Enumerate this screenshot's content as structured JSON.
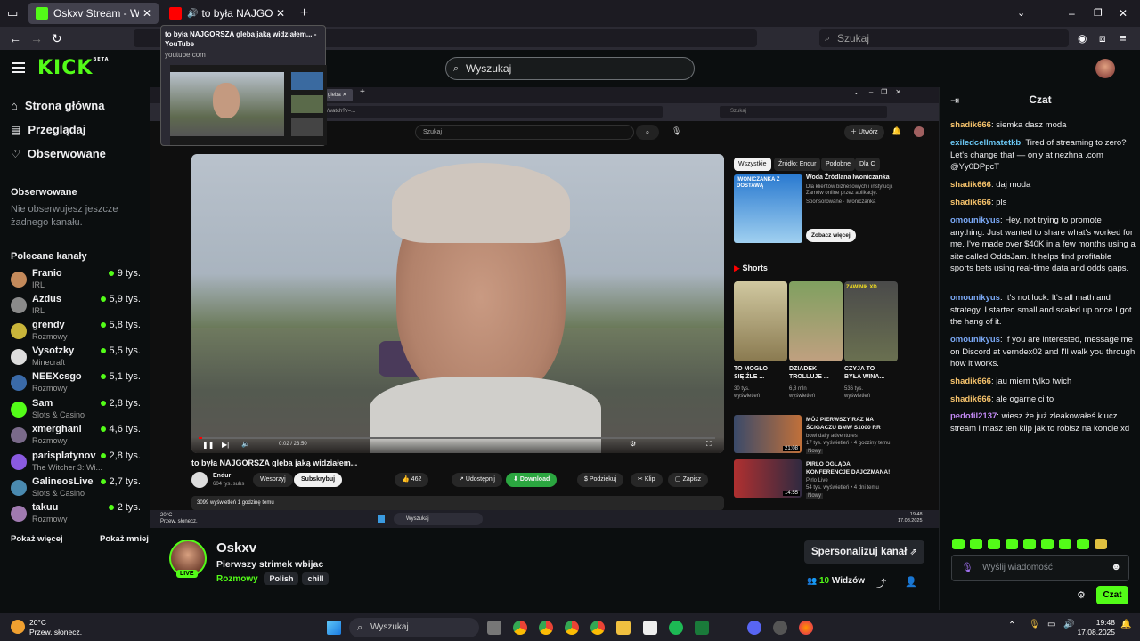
{
  "browser": {
    "tabs": [
      {
        "label": "Oskxv Stream - Watch Live on K",
        "active": true
      },
      {
        "label": "to była NAJGORSZA gleba",
        "active": false
      }
    ],
    "search_placeholder": "Szukaj",
    "tooltip": {
      "title": "to była NAJGORSZA gleba jaką widziałem... - YouTube",
      "domain": "youtube.com"
    }
  },
  "kick": {
    "logo": "KICK",
    "logo_badge": "BETA",
    "search_placeholder": "Wyszukaj",
    "nav": [
      {
        "icon": "home-icon",
        "label": "Strona główna"
      },
      {
        "icon": "browse-icon",
        "label": "Przeglądaj"
      },
      {
        "icon": "heart-icon",
        "label": "Obserwowane"
      }
    ],
    "following_heading": "Obserwowane",
    "following_empty": "Nie obserwujesz jeszcze żadnego kanału.",
    "recommended_heading": "Polecane kanały",
    "channels": [
      {
        "name": "Franio",
        "category": "IRL",
        "viewers": "9 tys.",
        "color": "#c48a5b"
      },
      {
        "name": "Azdus",
        "category": "IRL",
        "viewers": "5,9 tys.",
        "color": "#8a8a8a"
      },
      {
        "name": "grendy",
        "category": "Rozmowy",
        "viewers": "5,8 tys.",
        "color": "#c9b53a"
      },
      {
        "name": "Vysotzky",
        "category": "Minecraft",
        "viewers": "5,5 tys.",
        "color": "#dddddd"
      },
      {
        "name": "NEEXcsgo",
        "category": "Rozmowy",
        "viewers": "5,1 tys.",
        "color": "#3a6aa8"
      },
      {
        "name": "Sam",
        "category": "Slots & Casino",
        "viewers": "2,8 tys.",
        "color": "#53fc18"
      },
      {
        "name": "xmerghani",
        "category": "Rozmowy",
        "viewers": "4,6 tys.",
        "color": "#7a6a8a"
      },
      {
        "name": "parisplatynov",
        "category": "The Witcher 3: Wi...",
        "viewers": "2,8 tys.",
        "color": "#8a5ae0"
      },
      {
        "name": "GalineosLive",
        "category": "Slots & Casino",
        "viewers": "2,7 tys.",
        "color": "#4a8ab0"
      },
      {
        "name": "takuu",
        "category": "Rozmowy",
        "viewers": "2 tys.",
        "color": "#a07ab0"
      }
    ],
    "show_more": "Pokaż więcej",
    "show_less": "Pokaż mniej"
  },
  "stream": {
    "streamer": "Oskxv",
    "title": "Pierwszy strimek wbijac",
    "category": "Rozmowy",
    "tags": [
      "Polish",
      "chill"
    ],
    "live_badge": "LIVE",
    "customize_button": "Spersonalizuj kanał",
    "viewers_count": "10",
    "viewers_label": "Widzów"
  },
  "youtube": {
    "search_placeholder": "Szukaj",
    "create_button": "Utwórz",
    "video_title": "to była NAJGORSZA gleba jaką widziałem...",
    "channel": "Endur",
    "subs": "604 tys. subs",
    "support_button": "Wesprzyj",
    "subscribe_button": "Subskrybuj",
    "likes": "462",
    "share_button": "Udostępnij",
    "download_button": "Download",
    "thanks_button": "Podziękuj",
    "clip_button": "Klip",
    "save_button": "Zapisz",
    "views_line": "3099 wyświetleń  1 godzinę temu",
    "time": "0:02 / 23:50",
    "chips": [
      "Wszystkie",
      "Źródło: Endur",
      "Podobne",
      "Dla C"
    ],
    "ad": {
      "title": "Woda Źródlana Iwoniczanka",
      "desc": "Dla klientów biznesowych i instytucji. Zamów online przez aplikację.",
      "sponsor": "Sponsorowane · Iwoniczanka",
      "cta": "Zobacz więcej",
      "banner": "IWONICZANKA Z DOSTAWĄ"
    },
    "shorts_heading": "Shorts",
    "shorts": [
      {
        "title": "TO MOGŁO SIĘ ŹLE ...",
        "views": "30 tys. wyświetleń"
      },
      {
        "title": "DZIADEK TROLLUJE ...",
        "views": "6,8 mln wyświetleń"
      },
      {
        "title": "CZYJA TO BYŁA WINA...",
        "views": "536 tys. wyświetleń",
        "overlay": "ZAWINIŁ XD"
      }
    ],
    "related": [
      {
        "title": "MÓJ PIERWSZY RAZ NA ŚCIGACZU BMW S1000 RR",
        "channel": "bowi daily adventures",
        "meta": "17 tys. wyświetleń • 4 godziny temu",
        "badge": "Nowy",
        "duration": "21:08"
      },
      {
        "title": "PIRLO OGLĄDA KONFERENCJE DAJCZMANA!",
        "channel": "Pirlo Live",
        "meta": "54 tys. wyświetleń • 4 dni temu",
        "badge": "Nowy",
        "duration": "14:55"
      }
    ]
  },
  "chat": {
    "title": "Czat",
    "messages": [
      {
        "user": "shadik666",
        "color": "#f5c26b",
        "text": "siemka dasz moda"
      },
      {
        "user": "exiledcellmatetkb",
        "color": "#6bc8f5",
        "text": "Tired of streaming to zero? Let's change that — only at nezhna .com @Yy0DPpcT"
      },
      {
        "user": "shadik666",
        "color": "#f5c26b",
        "text": "daj moda"
      },
      {
        "user": "shadik666",
        "color": "#f5c26b",
        "text": "pls"
      },
      {
        "user": "omounikyus",
        "color": "#7aa8f5",
        "text": "Hey, not trying to promote anything. Just wanted to share what's worked for me. I've made over $40K in a few months using a site called OddsJam. It helps find profitable sports bets using real-time data and odds gaps."
      },
      {
        "user": "omounikyus",
        "color": "#7aa8f5",
        "text": "It's not luck. It's all math and strategy. I started small and scaled up once I got the hang of it."
      },
      {
        "user": "omounikyus",
        "color": "#7aa8f5",
        "text": "If you are interested, message me on Discord at verndex02 and I'll walk you through how it works."
      },
      {
        "user": "shadik666",
        "color": "#f5c26b",
        "text": "jau miem tylko twich"
      },
      {
        "user": "shadik666",
        "color": "#f5c26b",
        "text": "ale ogarne ci to"
      },
      {
        "user": "pedofil2137",
        "color": "#c38af5",
        "text": "wiesz że już zleakowałeś klucz stream i masz ten klip jak to robisz na koncie xd"
      }
    ],
    "input_placeholder": "Wyślij wiadomość",
    "send_button": "Czat"
  },
  "taskbar": {
    "weather_temp": "20°C",
    "weather_desc": "Przew. słonecz.",
    "search_placeholder": "Wyszukaj",
    "time": "19:48",
    "date": "17.08.2025"
  },
  "colors": {
    "accent": "#53fc18",
    "bg": "#0b0e0f"
  }
}
